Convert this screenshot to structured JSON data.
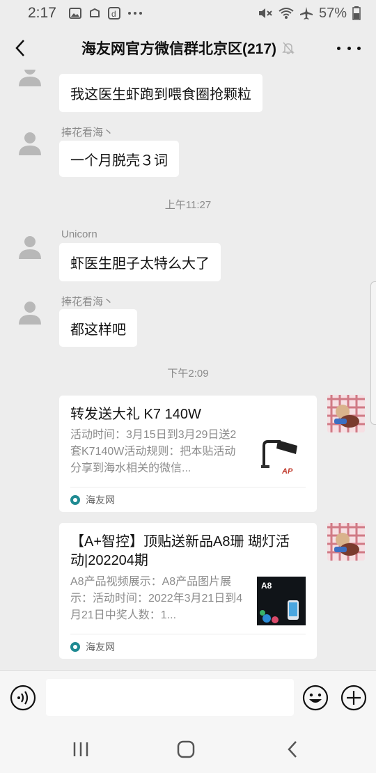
{
  "status_bar": {
    "time": "2:17",
    "battery": "57%"
  },
  "header": {
    "title": "海友网官方微信群北京区(217)"
  },
  "messages": [
    {
      "sender": "",
      "text": "我这医生虾跑到喂食圈抢颗粒"
    },
    {
      "sender": "捧花看海丶",
      "text": "一个月脱壳３词"
    },
    {
      "time": "上午11:27"
    },
    {
      "sender": "Unicorn",
      "text": "虾医生胆子太特么大了"
    },
    {
      "sender": "捧花看海丶",
      "text": "都这样吧"
    },
    {
      "time": "下午2:09"
    }
  ],
  "cards": [
    {
      "title": "转发送大礼  K7 140W",
      "description": "活动时间：3月15日到3月29日送2套K7140W活动规则：把本贴活动分享到海水相关的微信...",
      "source": "海友网"
    },
    {
      "title": "【A+智控】顶贴送新品A8珊 瑚灯活动|202204期",
      "description": "A8产品视频展示：A8产品图片展示：活动时间：2022年3月21日到4月21日中奖人数：1...",
      "thumb_label": "A8",
      "source": "海友网"
    }
  ],
  "input": {
    "value": "",
    "placeholder": ""
  },
  "colors": {
    "background": "#ededed",
    "bubble": "#ffffff",
    "source_logo": "#1f8a92"
  },
  "icons": [
    "back-arrow-icon",
    "mute-bell-icon",
    "more-icon",
    "voice-icon",
    "emoji-icon",
    "plus-icon",
    "recent-apps-icon",
    "home-icon",
    "nav-back-icon"
  ]
}
